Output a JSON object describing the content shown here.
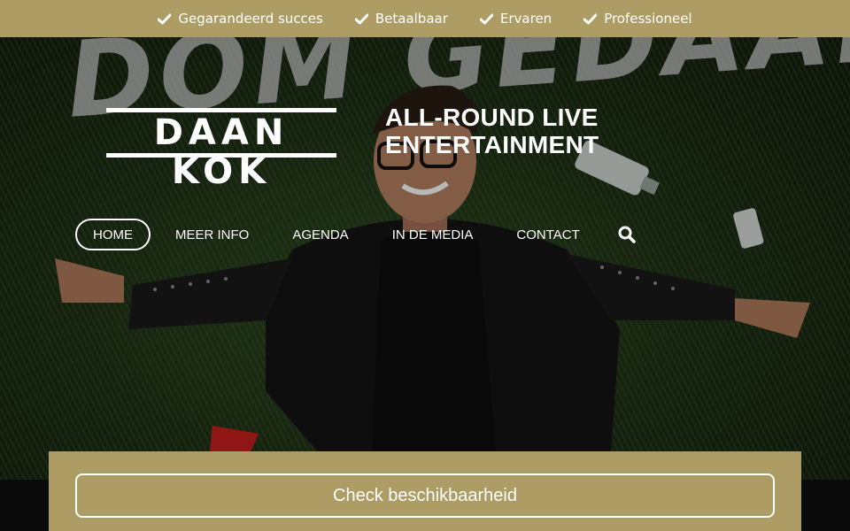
{
  "theme": {
    "gold": "#ad9c63",
    "text": "#ffffff"
  },
  "usp": {
    "items": [
      {
        "label": "Gegarandeerd succes",
        "icon": "check-icon"
      },
      {
        "label": "Betaalbaar",
        "icon": "check-icon"
      },
      {
        "label": "Ervaren",
        "icon": "check-icon"
      },
      {
        "label": "Professioneel",
        "icon": "check-icon"
      }
    ]
  },
  "hero": {
    "background_text": "DOM GEDAAN",
    "logo_text": "DAAN KOK",
    "tagline_line1": "ALL-ROUND LIVE",
    "tagline_line2": "ENTERTAINMENT"
  },
  "nav": {
    "items": [
      {
        "label": "HOME",
        "active": true
      },
      {
        "label": "MEER INFO",
        "active": false
      },
      {
        "label": "AGENDA",
        "active": false
      },
      {
        "label": "IN DE MEDIA",
        "active": false
      },
      {
        "label": "CONTACT",
        "active": false
      }
    ],
    "search_icon": "search-icon"
  },
  "cta": {
    "button_label": "Check beschikbaarheid"
  }
}
